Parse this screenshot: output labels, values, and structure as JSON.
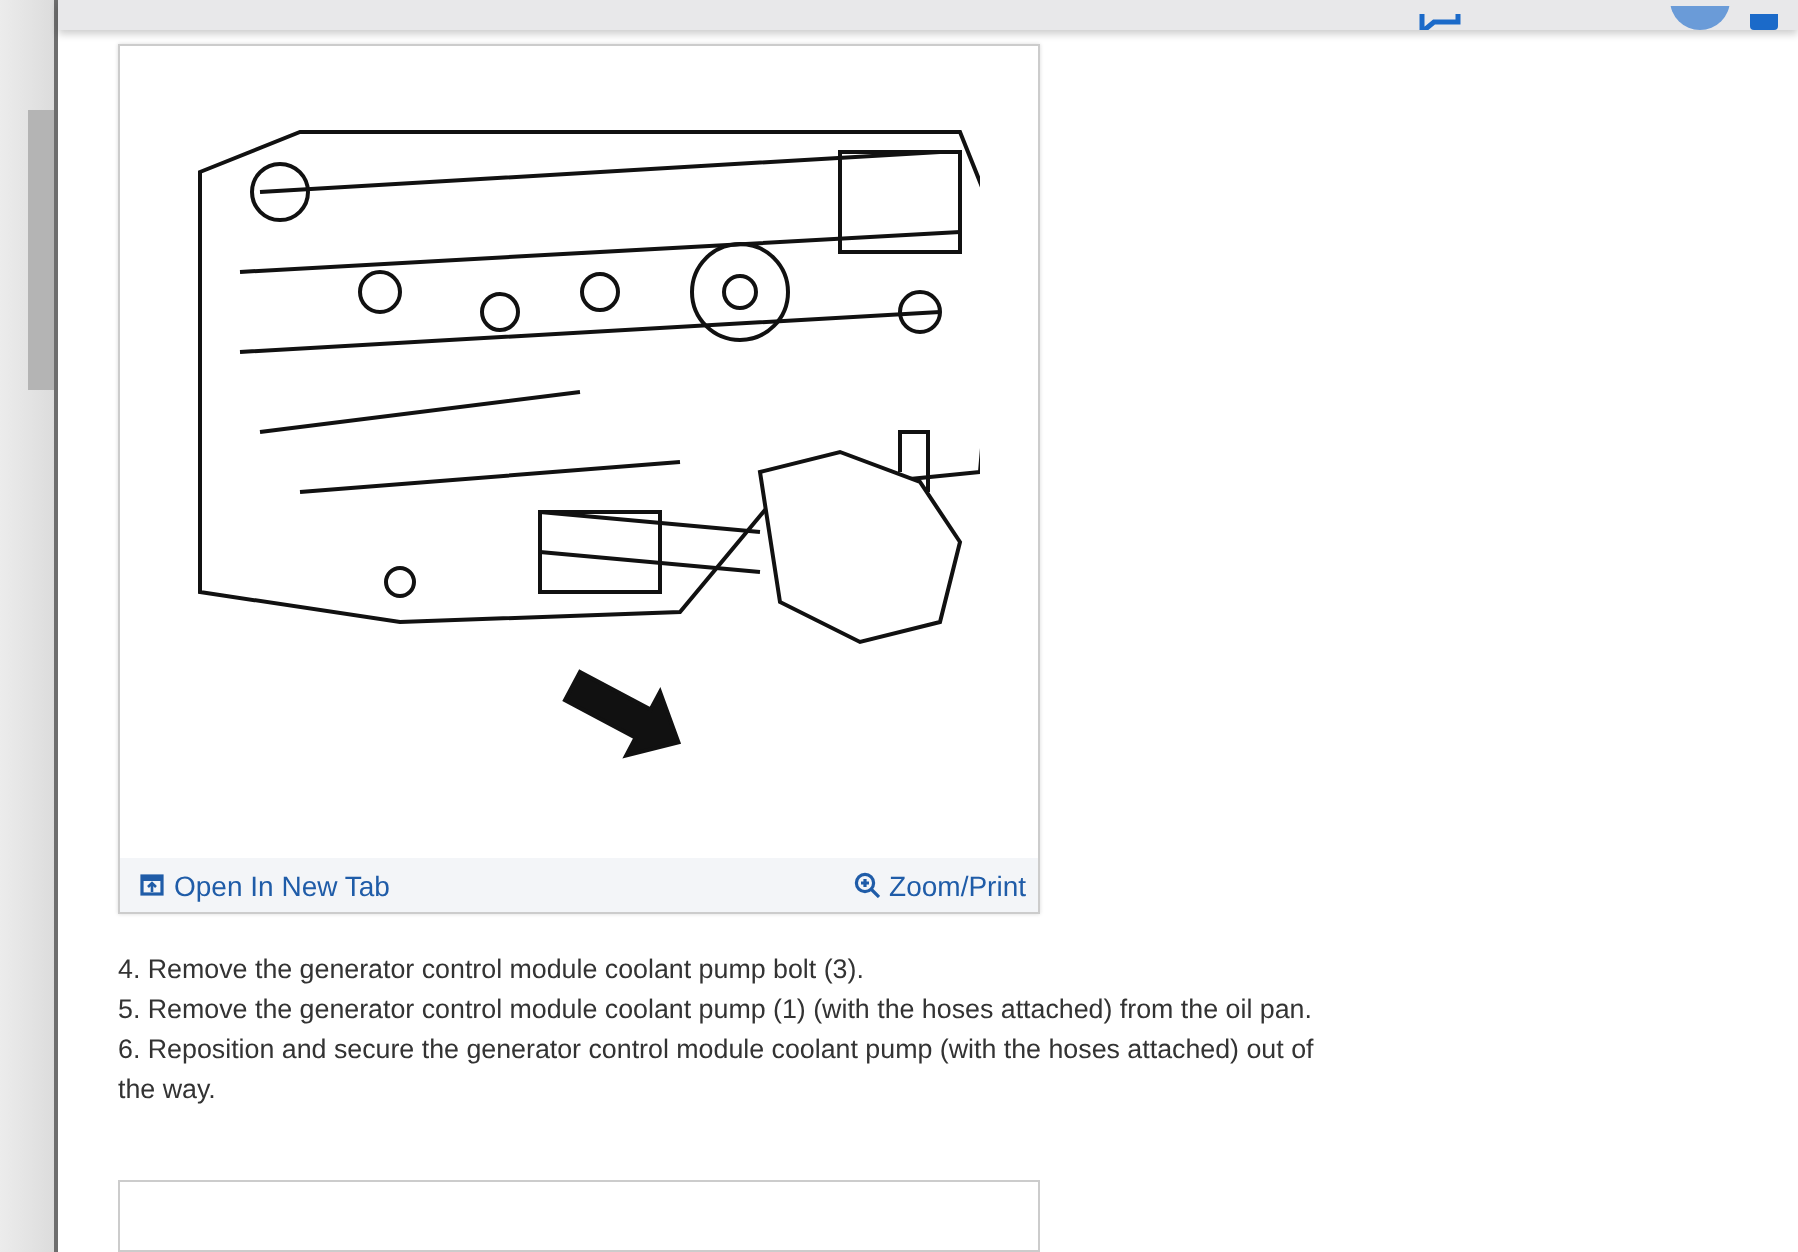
{
  "figure": {
    "caption_links": [
      {
        "kind": "open",
        "label": "Open In New Tab"
      },
      {
        "kind": "zoom",
        "label": "Zoom/Print"
      }
    ]
  },
  "steps": [
    "4. Remove the generator control module coolant pump bolt (3).",
    "5. Remove the generator control module coolant pump (1) (with the hoses attached) from the oil pan.",
    "6. Reposition and secure the generator control module coolant pump (with the hoses attached) out of the way."
  ]
}
